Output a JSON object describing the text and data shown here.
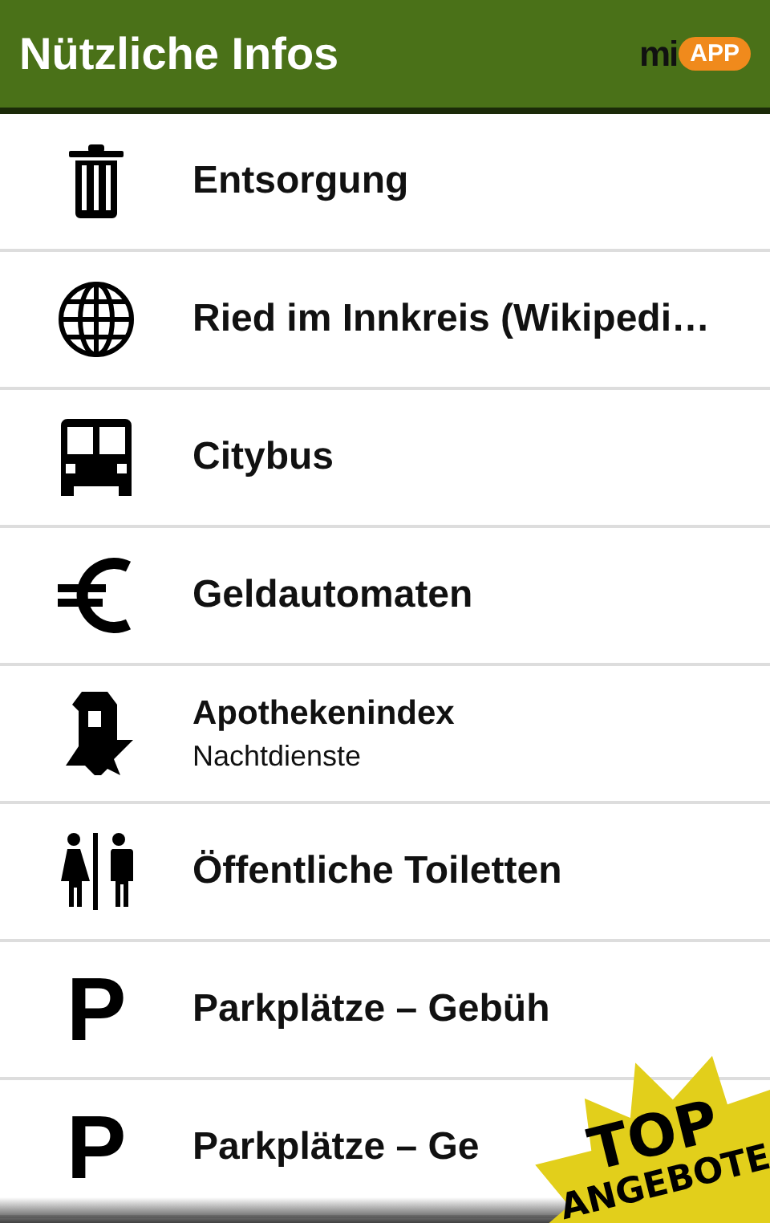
{
  "header": {
    "title": "Nützliche Infos",
    "logo": {
      "word": "mi",
      "badge": "APP"
    }
  },
  "items": [
    {
      "kind": "trash",
      "title": "Entsorgung"
    },
    {
      "kind": "globe",
      "title": "Ried im Innkreis (Wikipedi…"
    },
    {
      "kind": "bus",
      "title": "Citybus"
    },
    {
      "kind": "euro",
      "title": "Geldautomaten"
    },
    {
      "kind": "pharmacy",
      "title": "Apothekenindex",
      "subtitle": "Nachtdienste"
    },
    {
      "kind": "toilet",
      "title": "Öffentliche Toiletten"
    },
    {
      "kind": "parking",
      "symbol": "P",
      "title": "Parkplätze – Gebüh"
    },
    {
      "kind": "parking",
      "symbol": "P",
      "title": "Parkplätze – Ge"
    }
  ],
  "promo": {
    "line_1": "TOP",
    "line_2": "ANGEBOTE"
  }
}
